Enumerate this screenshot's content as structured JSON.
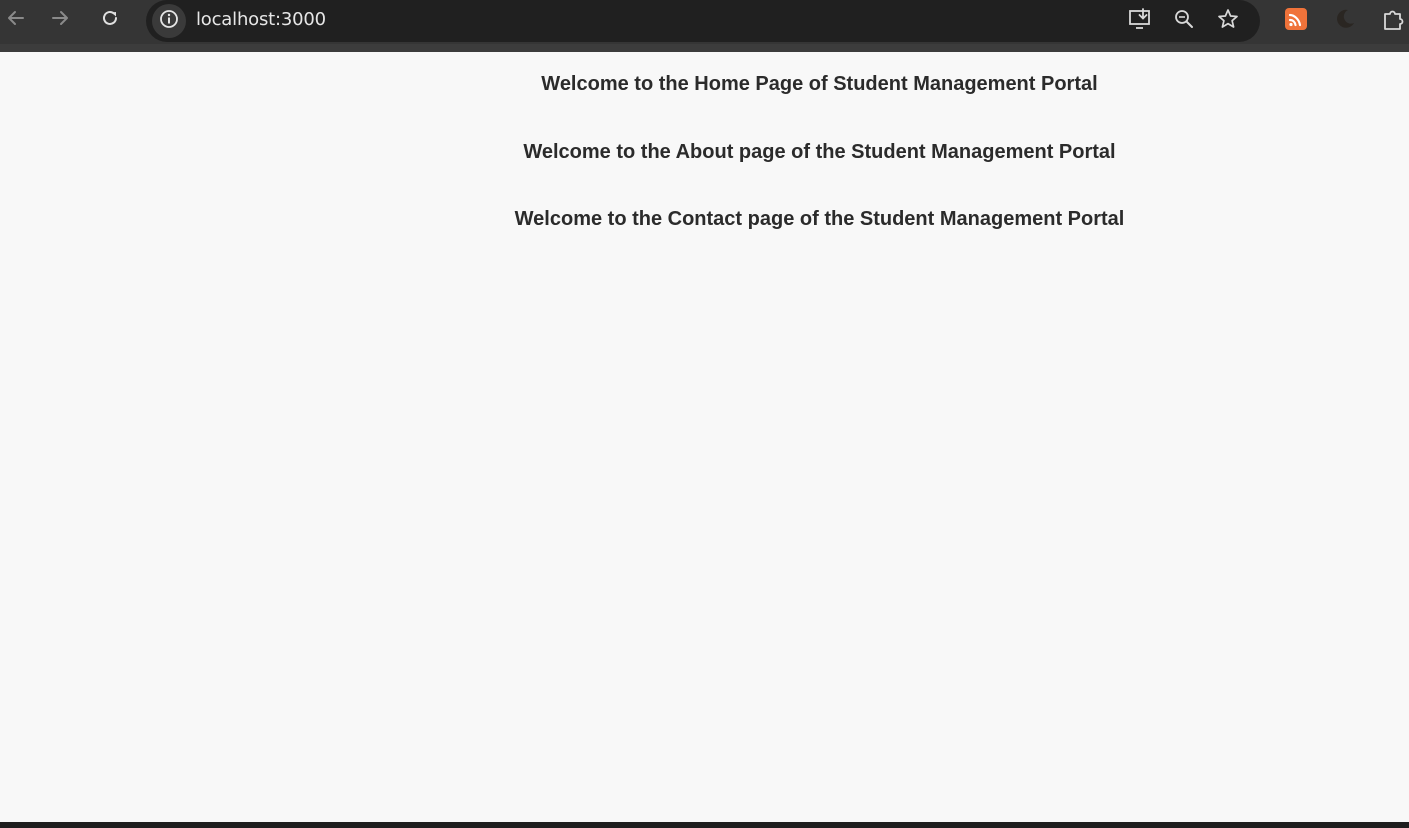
{
  "browser": {
    "url": "localhost:3000",
    "icons": {
      "back": "arrow-left-icon",
      "forward": "arrow-right-icon",
      "reload": "reload-icon",
      "site_info": "info-icon",
      "install": "install-app-icon",
      "zoom": "zoom-icon",
      "bookmark": "star-icon",
      "extension_1": "orange-extension-icon",
      "extension_2": "moon-icon",
      "extensions_menu": "puzzle-icon"
    },
    "colors": {
      "toolbar": "#353535",
      "omnibox": "#202020",
      "extension_orange": "#f0733a"
    }
  },
  "page": {
    "headings": [
      "Welcome to the Home Page of Student Management Portal",
      "Welcome to the About page of the Student Management Portal",
      "Welcome to the Contact page of the Student Management Portal"
    ],
    "colors": {
      "background": "#f8f8f8",
      "text": "#2b2b2b"
    }
  }
}
